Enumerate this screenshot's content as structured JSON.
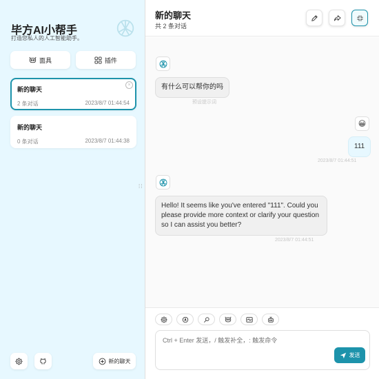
{
  "colors": {
    "accent": "#1d93ab",
    "sidebar_bg": "#e7f8ff",
    "user_bubble": "#e7f8ff",
    "bot_bubble": "#f0f0f0"
  },
  "sidebar": {
    "title": "毕方AI小帮手",
    "subtitle": "打造您私人的人工智能助手。",
    "logo_icon": "openai-logo-icon",
    "mask_label": "面具",
    "plugin_label": "插件",
    "chats": [
      {
        "title": "新的聊天",
        "count": "2 条对话",
        "time": "2023/8/7 01:44:54",
        "selected": true
      },
      {
        "title": "新的聊天",
        "count": "0 条对话",
        "time": "2023/8/7 01:44:38",
        "selected": false
      }
    ],
    "close_glyph": "×",
    "new_chat_label": "新的聊天",
    "drag_glyph": "⁞⁞"
  },
  "header": {
    "title": "新的聊天",
    "subtitle": "共 2 条对话",
    "icons": [
      "edit-icon",
      "share-icon",
      "fullscreen-exit-icon"
    ]
  },
  "messages": [
    {
      "role": "bot",
      "text": "有什么可以帮你的吗",
      "meta": "预设提示词"
    },
    {
      "role": "user",
      "avatar_emoji": "😀",
      "text": "111",
      "meta": "2023/8/7 01:44:51"
    },
    {
      "role": "bot",
      "text": "Hello! It seems like you've entered \"111\". Could you please provide more context or clarify your question so I can assist you better?",
      "meta": "2023/8/7 01:44:51"
    }
  ],
  "toolbar_icons": [
    "settings-icon",
    "theme-auto-icon",
    "prompt-icon",
    "mask-icon",
    "clear-context-icon",
    "robot-icon"
  ],
  "input": {
    "placeholder": "Ctrl + Enter 发送，/ 触发补全，: 触发命令",
    "send_label": "发送"
  }
}
